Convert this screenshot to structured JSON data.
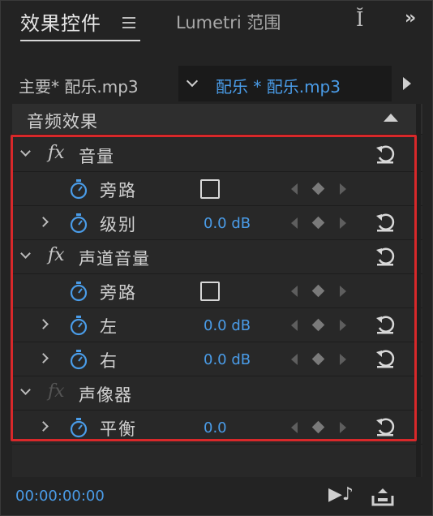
{
  "tabs": {
    "active_label": "效果控件",
    "inactive_label": "Lumetri 范围",
    "cursor_glyph": "Ĭ",
    "overflow_glyph": "»"
  },
  "clip_row": {
    "master_label": "主要* 配乐.mp3",
    "clip_label": "配乐 * 配乐.mp3"
  },
  "section": {
    "title": "音频效果"
  },
  "rows": [
    {
      "kind": "effect",
      "name": "音量",
      "fx_active": true
    },
    {
      "kind": "prop",
      "name": "旁路",
      "control": "checkbox"
    },
    {
      "kind": "prop",
      "name": "级别",
      "value": "0.0 dB"
    },
    {
      "kind": "effect",
      "name": "声道音量",
      "fx_active": true
    },
    {
      "kind": "prop",
      "name": "旁路",
      "control": "checkbox"
    },
    {
      "kind": "prop",
      "name": "左",
      "value": "0.0 dB"
    },
    {
      "kind": "prop",
      "name": "右",
      "value": "0.0 dB"
    },
    {
      "kind": "effect",
      "name": "声像器",
      "fx_active": false
    },
    {
      "kind": "prop",
      "name": "平衡",
      "value": "0.0"
    }
  ],
  "fx_label": "fx",
  "footer": {
    "timecode": "00:00:00:00",
    "audio_only_glyph": "▶♪"
  },
  "colors": {
    "accent_blue": "#4a9ce8",
    "highlight_red": "#d8282a",
    "panel_bg": "#232323"
  }
}
